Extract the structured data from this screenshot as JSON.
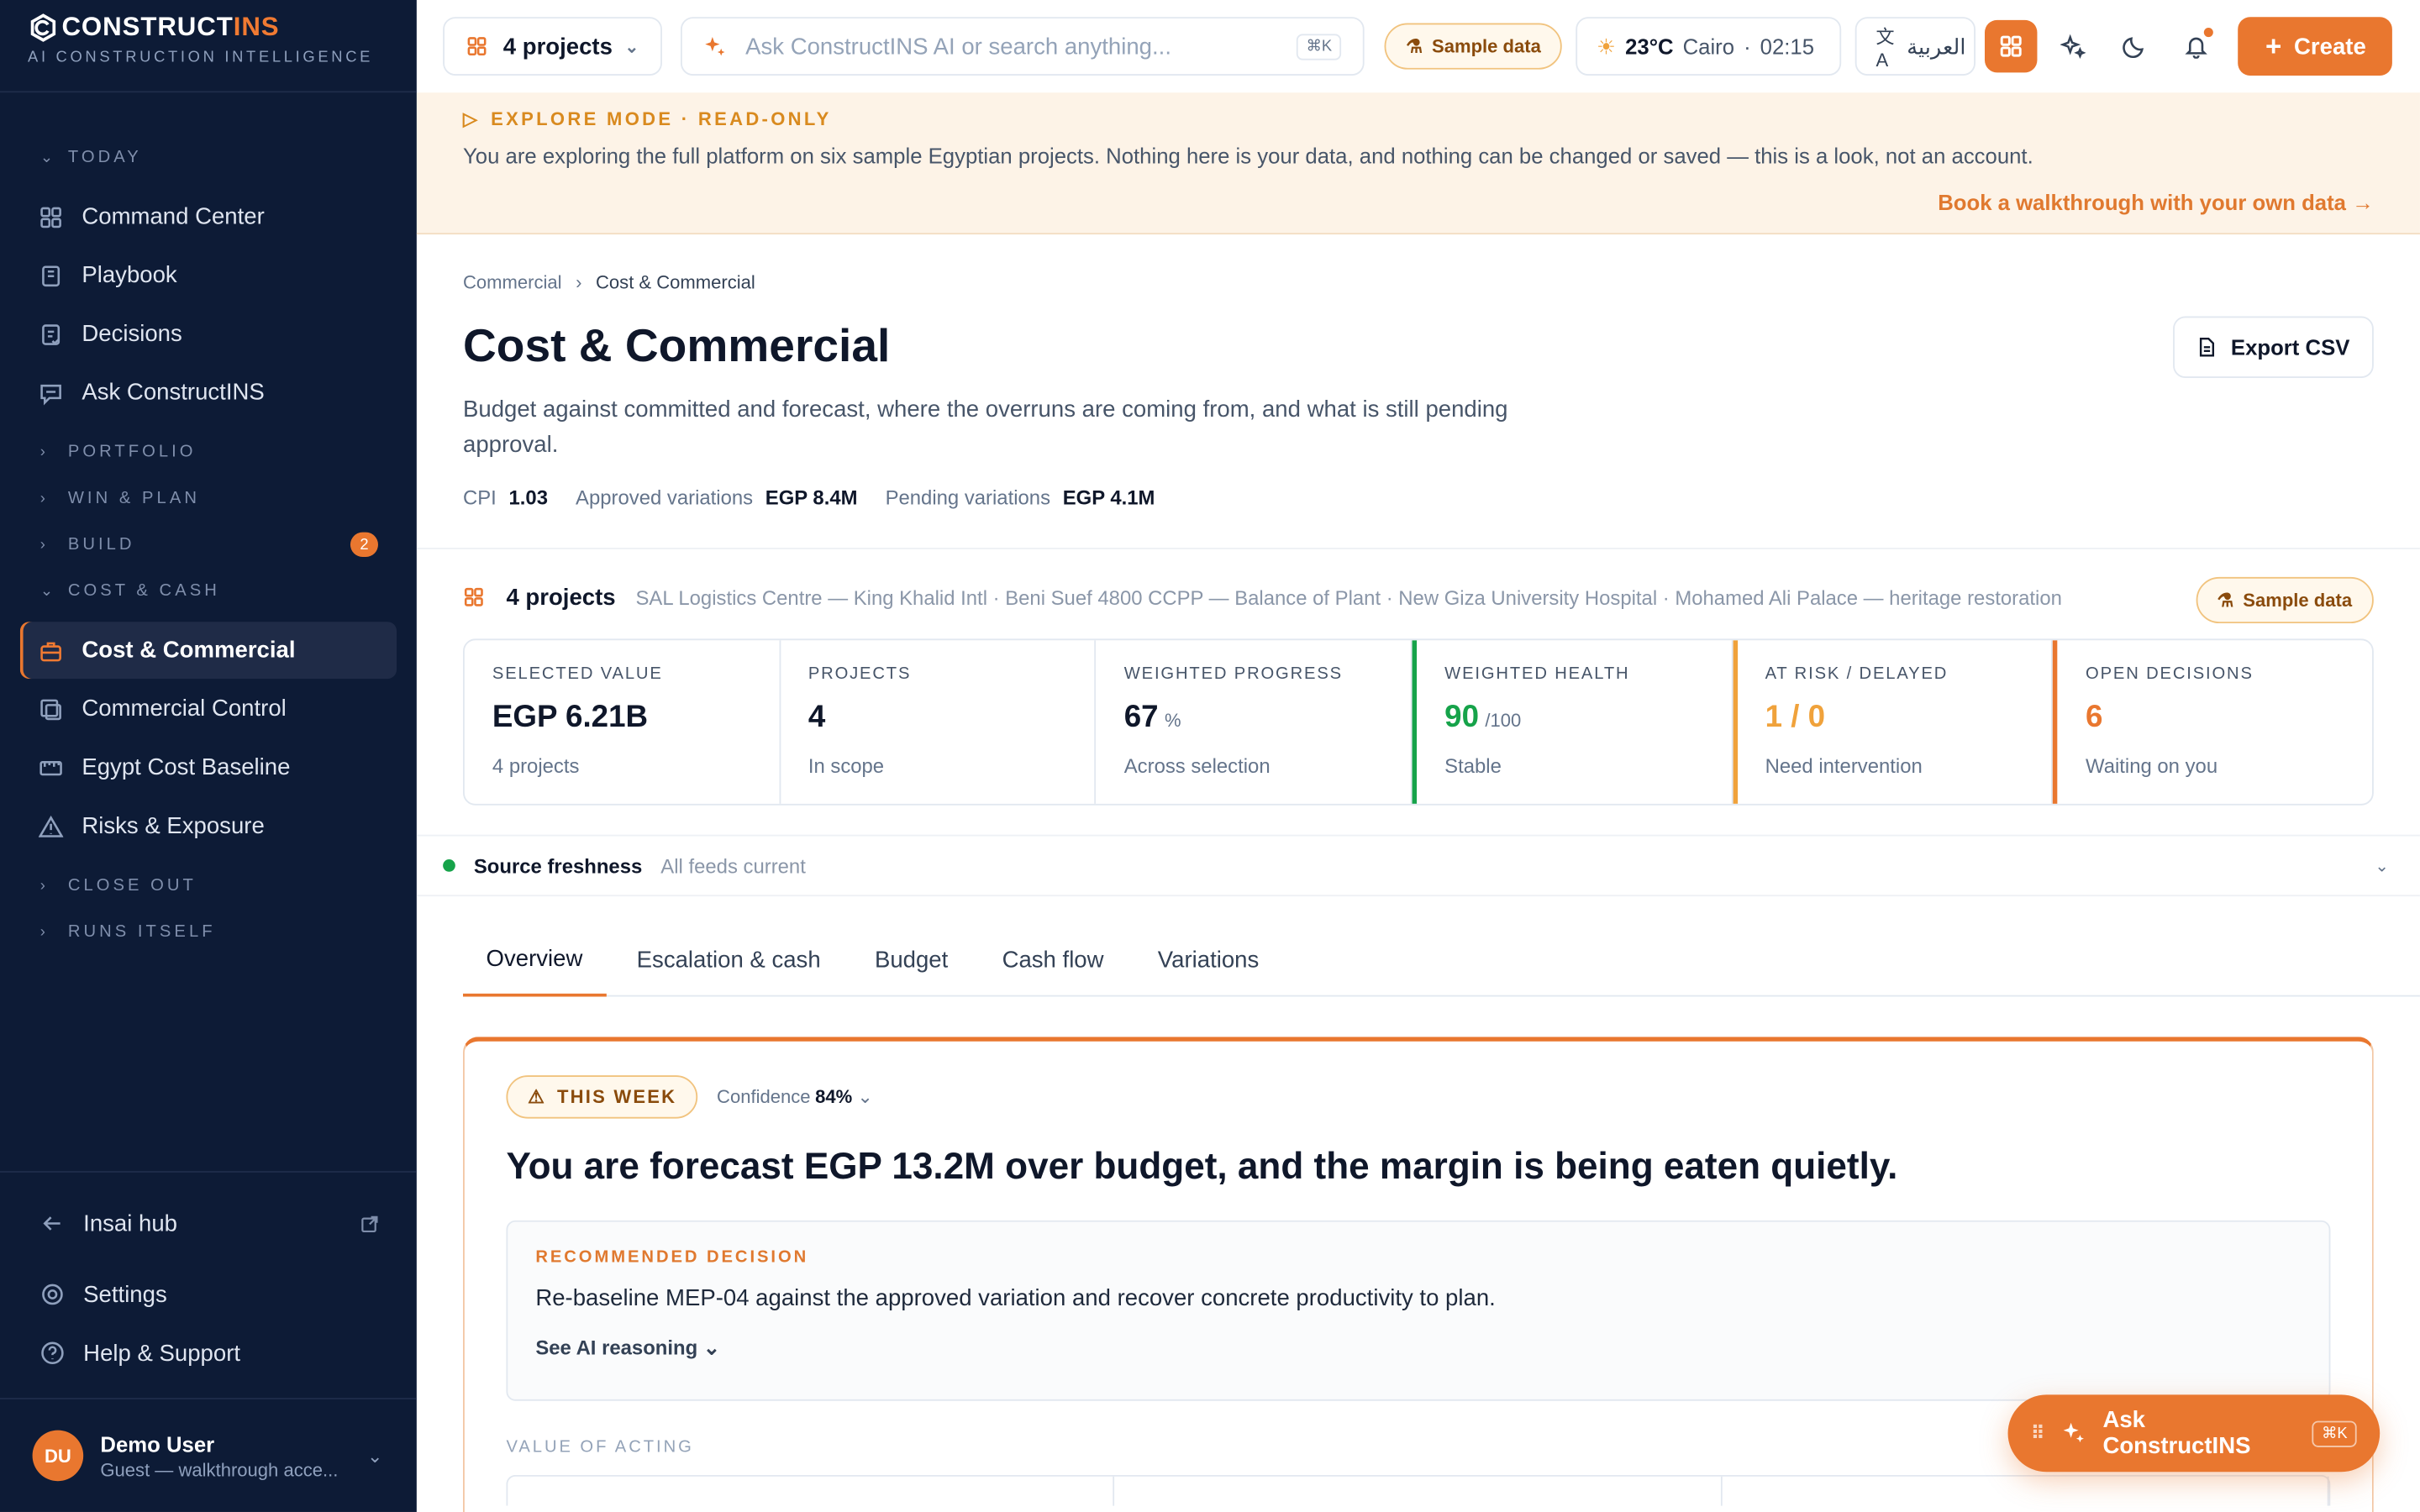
{
  "brand": {
    "name_a": "CONSTRUCT",
    "name_b": "INS",
    "tagline": "AI CONSTRUCTION INTELLIGENCE"
  },
  "sidebar": {
    "groups": [
      {
        "label": "TODAY",
        "expanded": true
      },
      {
        "label": "PORTFOLIO",
        "expanded": false
      },
      {
        "label": "WIN & PLAN",
        "expanded": false
      },
      {
        "label": "BUILD",
        "expanded": false,
        "badge": "2"
      },
      {
        "label": "COST & CASH",
        "expanded": true
      },
      {
        "label": "CLOSE OUT",
        "expanded": false
      },
      {
        "label": "RUNS ITSELF",
        "expanded": false
      }
    ],
    "today_items": [
      {
        "label": "Command Center",
        "icon": "grid-icon"
      },
      {
        "label": "Playbook",
        "icon": "book-icon"
      },
      {
        "label": "Decisions",
        "icon": "checklist-icon"
      },
      {
        "label": "Ask ConstructINS",
        "icon": "chat-icon"
      }
    ],
    "cost_items": [
      {
        "label": "Cost & Commercial",
        "icon": "briefcase-icon",
        "active": true
      },
      {
        "label": "Commercial Control",
        "icon": "control-icon"
      },
      {
        "label": "Egypt Cost Baseline",
        "icon": "ruler-icon"
      },
      {
        "label": "Risks & Exposure",
        "icon": "warning-icon"
      }
    ],
    "bottom": {
      "hub": "Insai hub",
      "settings": "Settings",
      "help": "Help & Support"
    },
    "user": {
      "initials": "DU",
      "name": "Demo User",
      "subtitle": "Guest — walkthrough acce..."
    }
  },
  "topbar": {
    "projects_label": "4 projects",
    "search_placeholder": "Ask ConstructINS AI or search anything...",
    "search_kbd": "⌘K",
    "sample_label": "Sample data",
    "weather": {
      "temp": "23°C",
      "city": "Cairo",
      "time": "02:15"
    },
    "language": "العربية",
    "create_label": "Create"
  },
  "banner": {
    "kicker": "EXPLORE MODE · READ-ONLY",
    "text": "You are exploring the full platform on six sample Egyptian projects. Nothing here is your data, and nothing can be changed or saved — this is a look, not an account.",
    "link": "Book a walkthrough with your own data →"
  },
  "header": {
    "breadcrumb": [
      "Commercial",
      "Cost & Commercial"
    ],
    "title": "Cost & Commercial",
    "subtitle": "Budget against committed and forecast, where the overruns are coming from, and what is still pending approval.",
    "export_label": "Export CSV",
    "metrics": [
      {
        "label": "CPI",
        "value": "1.03"
      },
      {
        "label": "Approved variations",
        "value": "EGP 8.4M"
      },
      {
        "label": "Pending variations",
        "value": "EGP 4.1M"
      }
    ]
  },
  "scope": {
    "count": "4 projects",
    "names": "SAL Logistics Centre — King Khalid Intl · Beni Suef 4800 CCPP — Balance of Plant · New Giza University Hospital · Mohamed Ali Palace — heritage restoration",
    "sample_label": "Sample data"
  },
  "kpis": [
    {
      "label": "SELECTED VALUE",
      "value": "EGP 6.21B",
      "unit": "",
      "sub": "4 projects",
      "tone": "default"
    },
    {
      "label": "PROJECTS",
      "value": "4",
      "unit": "",
      "sub": "In scope",
      "tone": "default"
    },
    {
      "label": "WEIGHTED PROGRESS",
      "value": "67",
      "unit": "%",
      "sub": "Across selection",
      "tone": "default"
    },
    {
      "label": "WEIGHTED HEALTH",
      "value": "90",
      "unit": "/100",
      "sub": "Stable",
      "tone": "green"
    },
    {
      "label": "AT RISK / DELAYED",
      "value": "1 / 0",
      "unit": "",
      "sub": "Need intervention",
      "tone": "amber"
    },
    {
      "label": "OPEN DECISIONS",
      "value": "6",
      "unit": "",
      "sub": "Waiting on you",
      "tone": "orange"
    }
  ],
  "freshness": {
    "label": "Source freshness",
    "status": "All feeds current"
  },
  "tabs": [
    "Overview",
    "Escalation & cash",
    "Budget",
    "Cash flow",
    "Variations"
  ],
  "insight": {
    "badge": "THIS WEEK",
    "confidence_label": "Confidence",
    "confidence_value": "84%",
    "headline": "You are forecast EGP 13.2M over budget, and the margin is being eaten quietly.",
    "rec_label": "RECOMMENDED DECISION",
    "rec_text": "Re-baseline MEP-04 against the approved variation and recover concrete productivity to plan.",
    "rec_link": "See AI reasoning",
    "value_label": "VALUE OF ACTING"
  },
  "ask": {
    "label": "Ask ConstructINS",
    "kbd": "⌘K"
  },
  "colors": {
    "accent": "#e9772f",
    "sidebar": "#0d1b36",
    "green": "#16a34a",
    "amber": "#f0a23b"
  }
}
